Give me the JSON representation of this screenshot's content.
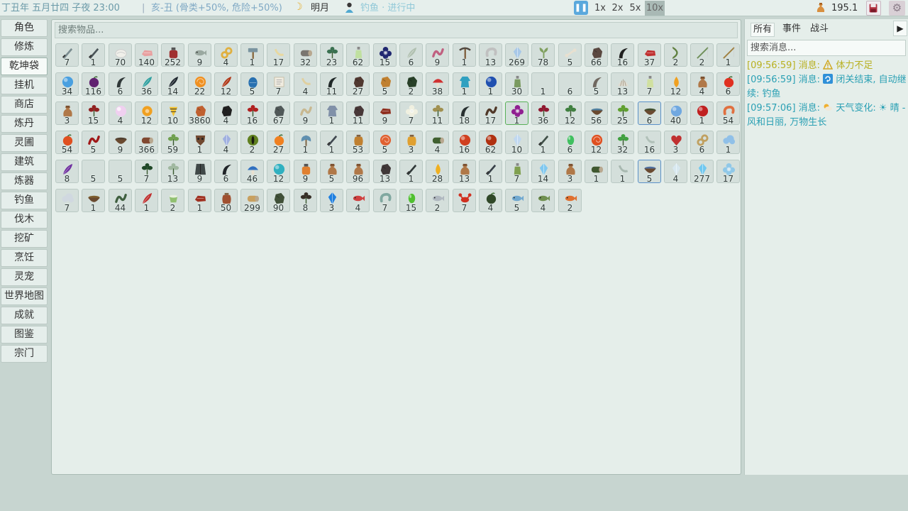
{
  "topbar": {
    "date": "丁丑年 五月廿四 子夜 23:00",
    "separator": "|",
    "season": "亥-丑 (骨类+50%, 危险+50%)",
    "moon_icon": "crescent-moon-icon",
    "moon": "明月",
    "fishing_icon": "fishing-person-icon",
    "fishing_status": "钓鱼 · 进行中",
    "pause_icon": "pause-icon",
    "speeds": [
      "1x",
      "2x",
      "5x",
      "10x"
    ],
    "active_speed": "10x",
    "money_icon": "money-bag-icon",
    "money": "195.1",
    "save_icon": "save-icon",
    "settings_icon": "gear-icon"
  },
  "sidebar": {
    "items": [
      "角色",
      "修炼",
      "乾坤袋",
      "挂机",
      "商店",
      "炼丹",
      "灵圃",
      "建筑",
      "炼器",
      "钓鱼",
      "伐木",
      "挖矿",
      "烹饪",
      "灵宠",
      "世界地图",
      "成就",
      "图鉴",
      "宗门"
    ],
    "active": "乾坤袋"
  },
  "inventory": {
    "search_placeholder": "搜索物品...",
    "items": [
      {
        "icon": "sword",
        "c": "#7a8c90",
        "q": "7"
      },
      {
        "icon": "sword",
        "c": "#4a5458",
        "q": "1"
      },
      {
        "icon": "silk",
        "c": "#f0f0ea",
        "q": "70"
      },
      {
        "icon": "meat",
        "c": "#e8a0a0",
        "q": "140"
      },
      {
        "icon": "potion",
        "c": "#a03030",
        "q": "252"
      },
      {
        "icon": "fish",
        "c": "#9aa8a0",
        "q": "9"
      },
      {
        "icon": "rope",
        "c": "#e0b040",
        "q": "4"
      },
      {
        "icon": "hammer",
        "c": "#7a94a0",
        "q": "1"
      },
      {
        "icon": "horn",
        "c": "#e8d8a0",
        "q": "17"
      },
      {
        "icon": "log",
        "c": "#7a7670",
        "q": "32"
      },
      {
        "icon": "herb",
        "c": "#3a7050",
        "q": "23"
      },
      {
        "icon": "bottle",
        "c": "#c0e0a0",
        "q": "62"
      },
      {
        "icon": "flower",
        "c": "#202870",
        "q": "15"
      },
      {
        "icon": "feather",
        "c": "#b0c0b0",
        "q": "6"
      },
      {
        "icon": "worm",
        "c": "#c06080",
        "q": "9"
      },
      {
        "icon": "pickaxe",
        "c": "#504840",
        "q": "1"
      },
      {
        "icon": "shrimp",
        "c": "#c0c0c0",
        "q": "13"
      },
      {
        "icon": "crystal",
        "c": "#a8c8e8",
        "q": "269"
      },
      {
        "icon": "sprout",
        "c": "#80a060",
        "q": "78"
      },
      {
        "icon": "bone",
        "c": "#e8e0d0",
        "q": "5"
      },
      {
        "icon": "ore",
        "c": "#5a4840",
        "q": "66"
      },
      {
        "icon": "claw",
        "c": "#202020",
        "q": "16"
      },
      {
        "icon": "meat",
        "c": "#c03030",
        "q": "37"
      },
      {
        "icon": "bow",
        "c": "#608040",
        "q": "2"
      },
      {
        "icon": "rod",
        "c": "#70905a",
        "q": "2"
      },
      {
        "icon": "rod",
        "c": "#a08040",
        "q": "1"
      },
      {
        "icon": "orb",
        "c": "#4aa0e0",
        "q": "34"
      },
      {
        "icon": "fruit",
        "c": "#602070",
        "q": "116"
      },
      {
        "icon": "claw",
        "c": "#303838",
        "q": "6"
      },
      {
        "icon": "feather",
        "c": "#30a0a0",
        "q": "36"
      },
      {
        "icon": "feather",
        "c": "#202830",
        "q": "14"
      },
      {
        "icon": "spiral",
        "c": "#f09020",
        "q": "22"
      },
      {
        "icon": "feather",
        "c": "#b03818",
        "q": "12"
      },
      {
        "icon": "egg",
        "c": "#2870b0",
        "q": "5"
      },
      {
        "icon": "scroll",
        "c": "#f0ece0",
        "q": "7"
      },
      {
        "icon": "horn",
        "c": "#e0d0a0",
        "q": "4"
      },
      {
        "icon": "claw",
        "c": "#202828",
        "q": "11"
      },
      {
        "icon": "ore",
        "c": "#503830",
        "q": "27"
      },
      {
        "icon": "ore",
        "c": "#c08030",
        "q": "5"
      },
      {
        "icon": "ore",
        "c": "#284028",
        "q": "2"
      },
      {
        "icon": "mushroom",
        "c": "#d03030",
        "q": "38"
      },
      {
        "icon": "robe",
        "c": "#30a0c0",
        "q": "1"
      },
      {
        "icon": "orb",
        "c": "#2050b0",
        "q": "1"
      },
      {
        "icon": "bottle",
        "c": "#7a9a60",
        "q": "30"
      },
      {
        "icon": "empty",
        "c": "#d4dfdb",
        "q": "1"
      },
      {
        "icon": "empty",
        "c": "#d4dfdb",
        "q": "6"
      },
      {
        "icon": "claw",
        "c": "#706860",
        "q": "5"
      },
      {
        "icon": "shell",
        "c": "#e0dcd0",
        "q": "13"
      },
      {
        "icon": "bottle",
        "c": "#d0e0a0",
        "q": "7"
      },
      {
        "icon": "drop",
        "c": "#f0a020",
        "q": "12"
      },
      {
        "icon": "bag",
        "c": "#b07848",
        "q": "4"
      },
      {
        "icon": "fruit",
        "c": "#e03020",
        "q": "6"
      },
      {
        "icon": "bag",
        "c": "#b07848",
        "q": "3"
      },
      {
        "icon": "herb",
        "c": "#902020",
        "q": "15"
      },
      {
        "icon": "pearl",
        "c": "#f0d0f0",
        "q": "4"
      },
      {
        "icon": "coin",
        "c": "#f0a020",
        "q": "12"
      },
      {
        "icon": "cone",
        "c": "#f0c030",
        "q": "10"
      },
      {
        "icon": "ore",
        "c": "#c06030",
        "q": "3860"
      },
      {
        "icon": "ore",
        "c": "#202020",
        "q": "4"
      },
      {
        "icon": "herb",
        "c": "#b02020",
        "q": "16"
      },
      {
        "icon": "ore",
        "c": "#505858",
        "q": "67"
      },
      {
        "icon": "worm",
        "c": "#c8b890",
        "q": "9"
      },
      {
        "icon": "robe",
        "c": "#8090a8",
        "q": "1"
      },
      {
        "icon": "ore",
        "c": "#483838",
        "q": "11"
      },
      {
        "icon": "meat",
        "c": "#903020",
        "q": "9"
      },
      {
        "icon": "flower",
        "c": "#f0f0e0",
        "q": "7"
      },
      {
        "icon": "herb",
        "c": "#a09050",
        "q": "11"
      },
      {
        "icon": "claw",
        "c": "#283030",
        "q": "18"
      },
      {
        "icon": "worm",
        "c": "#503828",
        "q": "17"
      },
      {
        "icon": "flower",
        "c": "#902090",
        "q": "1",
        "gr": true
      },
      {
        "icon": "herb",
        "c": "#901830",
        "q": "36"
      },
      {
        "icon": "herb",
        "c": "#408040",
        "q": "12"
      },
      {
        "icon": "bowl",
        "c": "#5080a0",
        "q": "56"
      },
      {
        "icon": "herb",
        "c": "#60a030",
        "q": "25"
      },
      {
        "icon": "bowl",
        "c": "#405030",
        "q": "6",
        "hl": true
      },
      {
        "icon": "orb",
        "c": "#70a8e0",
        "q": "40"
      },
      {
        "icon": "orb",
        "c": "#c02020",
        "q": "1"
      },
      {
        "icon": "shrimp",
        "c": "#e07040",
        "q": "54"
      },
      {
        "icon": "fruit",
        "c": "#e05020",
        "q": "54"
      },
      {
        "icon": "worm",
        "c": "#a01818",
        "q": "5"
      },
      {
        "icon": "bowl",
        "c": "#504030",
        "q": "9"
      },
      {
        "icon": "log",
        "c": "#804830",
        "q": "366"
      },
      {
        "icon": "herb",
        "c": "#70a050",
        "q": "59"
      },
      {
        "icon": "mask",
        "c": "#704830",
        "q": "1"
      },
      {
        "icon": "crystal",
        "c": "#a0b0e0",
        "q": "4"
      },
      {
        "icon": "eye",
        "c": "#608020",
        "q": "2"
      },
      {
        "icon": "fruit",
        "c": "#f08020",
        "q": "27"
      },
      {
        "icon": "axe",
        "c": "#6090b0",
        "q": "1"
      },
      {
        "icon": "sword",
        "c": "#404850",
        "q": "1"
      },
      {
        "icon": "jar",
        "c": "#c08030",
        "q": "53"
      },
      {
        "icon": "spiral",
        "c": "#e06030",
        "q": "5"
      },
      {
        "icon": "jar",
        "c": "#e0a030",
        "q": "3"
      },
      {
        "icon": "log",
        "c": "#406030",
        "q": "4"
      },
      {
        "icon": "orb",
        "c": "#d04020",
        "q": "16"
      },
      {
        "icon": "orb",
        "c": "#b03010",
        "q": "62"
      },
      {
        "icon": "crystal",
        "c": "#c0d8f0",
        "q": "10"
      },
      {
        "icon": "sword",
        "c": "#405048",
        "q": "1"
      },
      {
        "icon": "gem",
        "c": "#40c060",
        "q": "6"
      },
      {
        "icon": "spiral",
        "c": "#e05020",
        "q": "12"
      },
      {
        "icon": "herb",
        "c": "#40a040",
        "q": "32"
      },
      {
        "icon": "horn",
        "c": "#b0c0b8",
        "q": "16"
      },
      {
        "icon": "heart",
        "c": "#c03030",
        "q": "3"
      },
      {
        "icon": "rope",
        "c": "#c0a060",
        "q": "6"
      },
      {
        "icon": "cloud",
        "c": "#90c0e8",
        "q": "1"
      },
      {
        "icon": "feather",
        "c": "#7030a0",
        "q": "8"
      },
      {
        "icon": "empty",
        "c": "#d4dfdb",
        "q": "5"
      },
      {
        "icon": "empty",
        "c": "#d4dfdb",
        "q": "5"
      },
      {
        "icon": "herb",
        "c": "#204828",
        "q": "7"
      },
      {
        "icon": "herb",
        "c": "#a0b8a0",
        "q": "13"
      },
      {
        "icon": "cloak",
        "c": "#404848",
        "q": "9"
      },
      {
        "icon": "claw",
        "c": "#202428",
        "q": "6"
      },
      {
        "icon": "mushroom",
        "c": "#3070c0",
        "q": "46"
      },
      {
        "icon": "orb",
        "c": "#30b0c0",
        "q": "12"
      },
      {
        "icon": "potion",
        "c": "#e08030",
        "q": "9"
      },
      {
        "icon": "bag",
        "c": "#b07848",
        "q": "5"
      },
      {
        "icon": "bag",
        "c": "#b07848",
        "q": "96"
      },
      {
        "icon": "ore",
        "c": "#403838",
        "q": "13"
      },
      {
        "icon": "sword",
        "c": "#303838",
        "q": "1"
      },
      {
        "icon": "drop",
        "c": "#f0b020",
        "q": "28"
      },
      {
        "icon": "bag",
        "c": "#b07848",
        "q": "13"
      },
      {
        "icon": "sword",
        "c": "#384048",
        "q": "1"
      },
      {
        "icon": "bottle",
        "c": "#80a050",
        "q": "7"
      },
      {
        "icon": "crystal",
        "c": "#80c8f0",
        "q": "14"
      },
      {
        "icon": "bag",
        "c": "#b07848",
        "q": "3"
      },
      {
        "icon": "log",
        "c": "#405830",
        "q": "1"
      },
      {
        "icon": "horn",
        "c": "#a8b8b0",
        "q": "1"
      },
      {
        "icon": "bowl",
        "c": "#5070a0",
        "q": "5",
        "hl": true
      },
      {
        "icon": "crystal",
        "c": "#d8e8f0",
        "q": "4"
      },
      {
        "icon": "crystal",
        "c": "#70c8f0",
        "q": "277"
      },
      {
        "icon": "flower",
        "c": "#90c8e8",
        "q": "17"
      },
      {
        "icon": "cloud",
        "c": "#d0d8e0",
        "q": "7"
      },
      {
        "icon": "bowl",
        "c": "#806030",
        "q": "1"
      },
      {
        "icon": "worm",
        "c": "#406040",
        "q": "44"
      },
      {
        "icon": "feather",
        "c": "#c03030",
        "q": "1"
      },
      {
        "icon": "cup",
        "c": "#90c070",
        "q": "2"
      },
      {
        "icon": "meat",
        "c": "#a03020",
        "q": "1"
      },
      {
        "icon": "jar",
        "c": "#a05030",
        "q": "50"
      },
      {
        "icon": "log",
        "c": "#c8a060",
        "q": "299"
      },
      {
        "icon": "ore",
        "c": "#405038",
        "q": "90"
      },
      {
        "icon": "herb",
        "c": "#383028",
        "q": "8"
      },
      {
        "icon": "crystal",
        "c": "#2080e0",
        "q": "3"
      },
      {
        "icon": "fish",
        "c": "#d04040",
        "q": "4"
      },
      {
        "icon": "shrimp",
        "c": "#80a8a0",
        "q": "7"
      },
      {
        "icon": "gem",
        "c": "#50c030",
        "q": "15"
      },
      {
        "icon": "fish",
        "c": "#b0b8c0",
        "q": "2"
      },
      {
        "icon": "crab",
        "c": "#d03020",
        "q": "7"
      },
      {
        "icon": "fruit",
        "c": "#304828",
        "q": "4"
      },
      {
        "icon": "fish",
        "c": "#70a8d0",
        "q": "5"
      },
      {
        "icon": "fish",
        "c": "#709050",
        "q": "4"
      },
      {
        "icon": "fish",
        "c": "#e07030",
        "q": "2"
      }
    ]
  },
  "messages_panel": {
    "tabs": [
      "所有",
      "事件",
      "战斗"
    ],
    "active_tab": "所有",
    "play_icon": "play-icon",
    "search_placeholder": "搜索消息...",
    "messages": [
      {
        "time": "[09:56:59]",
        "label": "消息:",
        "icon": "warning-icon",
        "icon_glyph": "⚠",
        "text": "体力不足",
        "color": "#b8b020"
      },
      {
        "time": "[09:56:59]",
        "label": "消息:",
        "icon": "refresh-icon",
        "icon_glyph": "",
        "text": "闭关结束, 自动继续: 钓鱼",
        "color": "#2aa0b4"
      },
      {
        "time": "[09:57:06]",
        "label": "消息:",
        "icon": "weather-icon",
        "icon_glyph": "",
        "text": "天气变化: ☀ 晴 - 风和日丽, 万物生长",
        "color": "#2aa0b4"
      }
    ]
  }
}
